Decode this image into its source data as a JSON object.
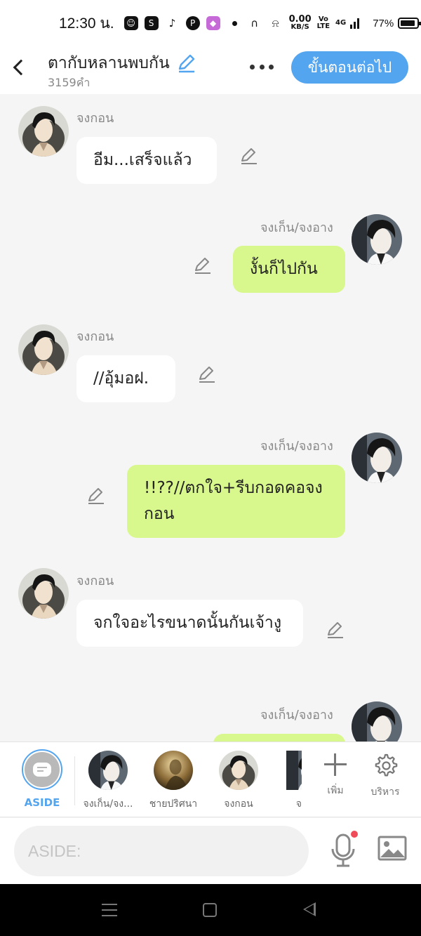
{
  "status_bar": {
    "time": "12:30 น.",
    "net_speed_value": "0.00",
    "net_speed_unit": "KB/S",
    "volte_top": "Vo",
    "volte_bottom": "LTE",
    "network": "4G",
    "battery": "77%"
  },
  "header": {
    "title": "ตากับหลานพบกัน",
    "word_count": "3159คำ",
    "next_label": "ขั้นตอนต่อไป"
  },
  "messages": [
    {
      "side": "left",
      "speaker": "จงกอน",
      "text": "อีม...เสร็จแล้ว",
      "avatar": "jonggon"
    },
    {
      "side": "right",
      "speaker": "จงเก็น/จงอาง",
      "text": "งั้นก็ไปกัน",
      "avatar": "jonggen"
    },
    {
      "side": "left",
      "speaker": "จงกอน",
      "text": "//อุ้มอฝ.",
      "avatar": "jonggon"
    },
    {
      "side": "right",
      "speaker": "จงเก็น/จงอาง",
      "text": "!!??//ตกใจ+รีบกอดคอจงกอน",
      "avatar": "jonggen"
    },
    {
      "side": "left",
      "speaker": "จงกอน",
      "text": "จกใจอะไรขนาดนั้นกันเจ้างู",
      "avatar": "jonggon"
    },
    {
      "side": "right",
      "speaker": "จงเก็น/จงอาง",
      "text": "",
      "avatar": "jonggen"
    }
  ],
  "character_bar": {
    "aside_label": "ASIDE",
    "characters": [
      {
        "label": "จงเก็น/จง...",
        "avatar": "jonggen"
      },
      {
        "label": "ชายปริศนา",
        "avatar": "mystery-man"
      },
      {
        "label": "จงกอน",
        "avatar": "jonggon"
      },
      {
        "label": "จ",
        "avatar": "partial-character"
      }
    ],
    "add_label": "เพิ่ม",
    "manage_label": "บริหาร"
  },
  "input": {
    "placeholder": "ASIDE:",
    "value": ""
  },
  "icons": {
    "back": "chevron-left-icon",
    "edit": "pencil-icon",
    "more": "more-dots-icon",
    "mic": "microphone-icon",
    "image": "image-icon",
    "add": "plus-icon",
    "manage": "gear-icon"
  },
  "colors": {
    "accent": "#53a5ef",
    "right_bubble": "#d8f78d",
    "left_bubble": "#ffffff",
    "background": "#f5f5f5",
    "notification_dot": "#ef4b59"
  }
}
